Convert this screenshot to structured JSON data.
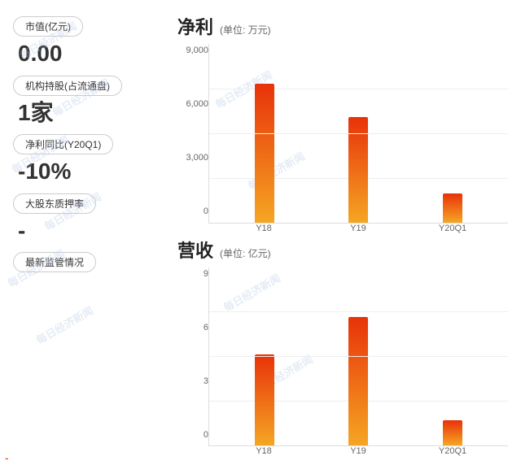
{
  "left": {
    "metrics": [
      {
        "id": "market-cap",
        "label": "市值(亿元)",
        "value": "0.00"
      },
      {
        "id": "institutional-holding",
        "label": "机构持股(占流通盘)",
        "value": "1家"
      },
      {
        "id": "net-profit-yoy",
        "label": "净利同比(Y20Q1)",
        "value": "-10%"
      },
      {
        "id": "major-shareholder",
        "label": "大股东质押率",
        "value": "-"
      },
      {
        "id": "latest-supervision",
        "label": "最新监管情况",
        "value": ""
      }
    ]
  },
  "charts": {
    "net_profit": {
      "title": "净利",
      "unit": "(单位: 万元)",
      "y_labels": [
        "9,000",
        "6,000",
        "3,000",
        "0"
      ],
      "bars": [
        {
          "label": "Y18",
          "height_pct": 95
        },
        {
          "label": "Y19",
          "height_pct": 72
        },
        {
          "label": "Y20Q1",
          "height_pct": 20
        }
      ]
    },
    "revenue": {
      "title": "营收",
      "unit": "(单位: 亿元)",
      "y_labels": [
        "9",
        "6",
        "3",
        "0"
      ],
      "bars": [
        {
          "label": "Y18",
          "height_pct": 62
        },
        {
          "label": "Y19",
          "height_pct": 88
        },
        {
          "label": "Y20Q1",
          "height_pct": 17
        }
      ]
    }
  },
  "watermarks": [
    "每日经济新闻",
    "每日经济新闻",
    "每日经济新闻",
    "每日经济新闻",
    "每日经济新闻",
    "每日经济新闻"
  ],
  "bottom_dash": "-"
}
